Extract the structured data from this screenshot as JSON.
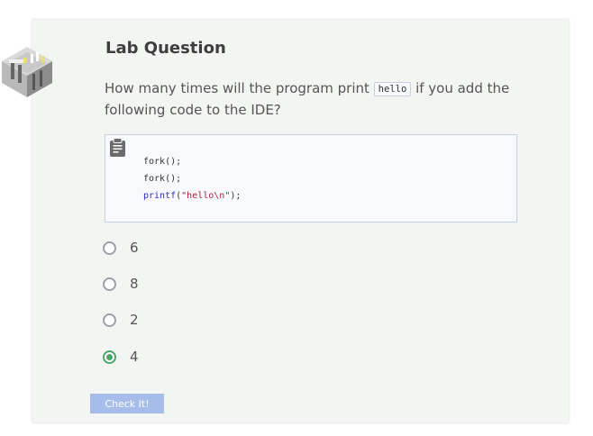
{
  "title": "Lab Question",
  "question": {
    "text_before": "How many times will the program print",
    "inline_code": "hello",
    "text_after": "if you add the following code to the IDE?"
  },
  "code": {
    "lines": [
      {
        "plain": "fork();"
      },
      {
        "plain": "fork();"
      },
      {
        "fn": "printf",
        "open": "(",
        "str": "\"hello\\n\"",
        "close": ");"
      }
    ]
  },
  "options": [
    {
      "label": "6",
      "checked": false
    },
    {
      "label": "8",
      "checked": false
    },
    {
      "label": "2",
      "checked": false
    },
    {
      "label": "4",
      "checked": true
    }
  ],
  "check_button": "Check It!",
  "icons": {
    "lab": "lab-building-icon",
    "clipboard": "clipboard-icon"
  },
  "colors": {
    "selected": "#4aa56a",
    "button": "#a5bde8"
  }
}
